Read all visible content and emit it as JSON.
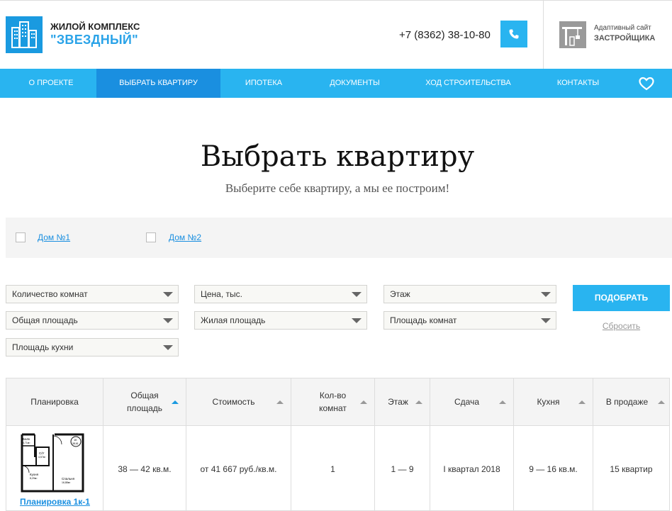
{
  "header": {
    "logo_line1": "ЖИЛОЙ КОМПЛЕКС",
    "logo_line2": "\"ЗВЕЗДНЫЙ\"",
    "phone": "+7 (8362) 38-10-80",
    "dev_line1": "Адаптивный сайт",
    "dev_line2": "ЗАСТРОЙЩИКА"
  },
  "nav": {
    "items": [
      {
        "label": "О ПРОЕКТЕ"
      },
      {
        "label": "ВЫБРАТЬ КВАРТИРУ"
      },
      {
        "label": "ИПОТЕКА"
      },
      {
        "label": "ДОКУМЕНТЫ"
      },
      {
        "label": "ХОД СТРОИТЕЛЬСТВА"
      },
      {
        "label": "КОНТАКТЫ"
      }
    ],
    "active_index": 1
  },
  "page": {
    "title": "Выбрать квартиру",
    "subtitle": "Выберите себе квартиру, а мы ее построим!"
  },
  "houses": [
    {
      "label": "Дом №1",
      "checked": false
    },
    {
      "label": "Дом №2",
      "checked": false
    }
  ],
  "filters": {
    "rooms": "Количество комнат",
    "price": "Цена, тыс.",
    "floor": "Этаж",
    "total_area": "Общая площадь",
    "living_area": "Жилая площадь",
    "room_area": "Площадь комнат",
    "kitchen_area": "Площадь кухни",
    "submit": "ПОДОБРАТЬ",
    "reset": "Сбросить"
  },
  "table": {
    "headers": {
      "plan": "Планировка",
      "area_l1": "Общая",
      "area_l2": "площадь",
      "price": "Стоимость",
      "rooms_l1": "Кол-во",
      "rooms_l2": "комнат",
      "floor": "Этаж",
      "delivery": "Сдача",
      "kitchen": "Кухня",
      "onsale": "В продаже"
    },
    "rows": [
      {
        "plan_link": "Планировка 1к-1",
        "area": "38 — 42 кв.м.",
        "price": "от 41 667 руб./кв.м.",
        "rooms": "1",
        "floor": "1 — 9",
        "delivery": "I квартал 2018",
        "kitchen": "9 — 16 кв.м.",
        "onsale": "15 квартир"
      }
    ]
  },
  "plan_labels": {
    "balcony": "Балк",
    "balcony_area": "4,71м²",
    "bath": "С/У",
    "bath_area": "4,57м²",
    "badge_top": "1К",
    "badge_bottom": "38,61",
    "kitchen": "Кухня",
    "kitchen_area": "8,29м²",
    "bedroom": "Спальня",
    "bedroom_area": "16,88м²"
  },
  "colors": {
    "accent": "#29b4f0",
    "accent_dark": "#1a8fe0"
  }
}
